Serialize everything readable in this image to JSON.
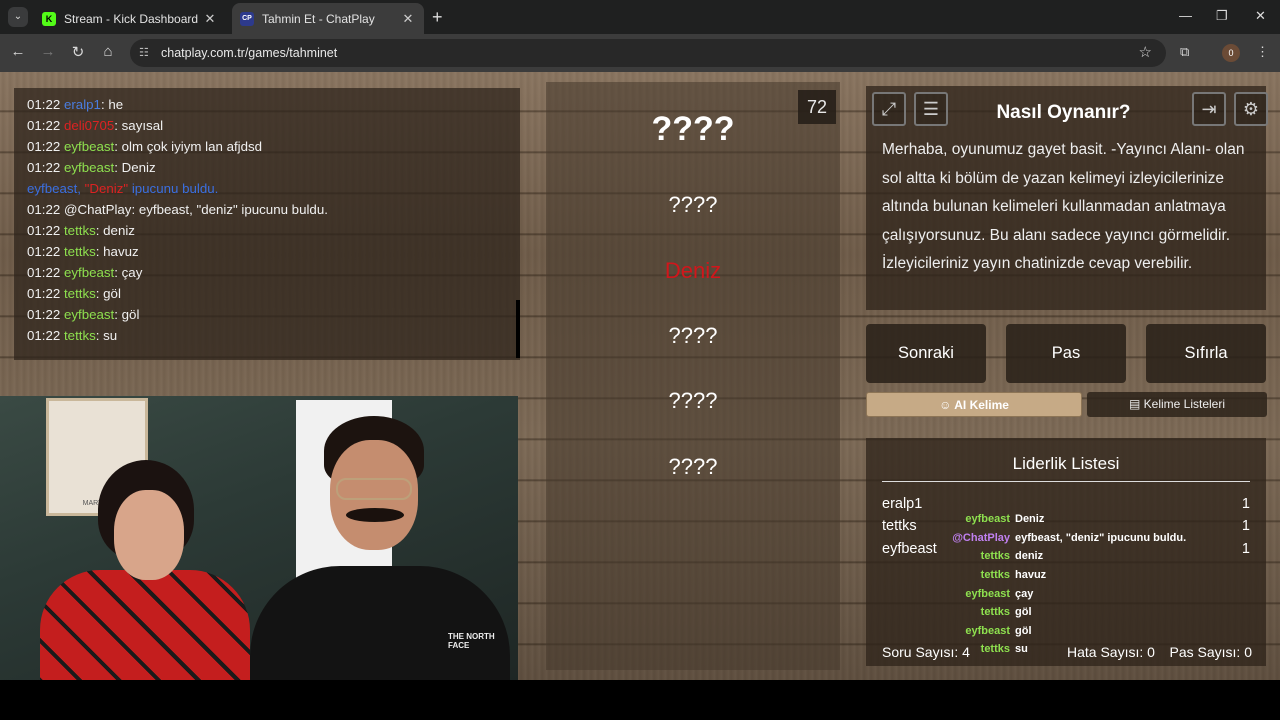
{
  "browser": {
    "tabs": [
      {
        "label": "Stream - Kick Dashboard",
        "favicon": "K",
        "active": false
      },
      {
        "label": "Tahmin Et - ChatPlay",
        "favicon": "CP",
        "active": true
      }
    ],
    "url": "chatplay.com.tr/games/tahminet",
    "profile_initial": "0"
  },
  "chat": [
    {
      "time": "01:22",
      "user": "eralp1",
      "color": "blue",
      "message": "he"
    },
    {
      "time": "01:22",
      "user": "deli0705",
      "color": "red",
      "message": "sayısal"
    },
    {
      "time": "01:22",
      "user": "eyfbeast",
      "color": "green",
      "message": "olm çok iyiym lan afjdsd"
    },
    {
      "time": "01:22",
      "user": "eyfbeast",
      "color": "green",
      "message": "Deniz"
    },
    {
      "notice_user": "eyfbeast,",
      "notice_word": "\"Deniz\"",
      "notice_text": "ipucunu buldu."
    },
    {
      "time": "01:22",
      "user": "@ChatPlay",
      "color": "white",
      "message": "eyfbeast, \"deniz\" ipucunu buldu."
    },
    {
      "time": "01:22",
      "user": "tettks",
      "color": "green",
      "message": "deniz"
    },
    {
      "time": "01:22",
      "user": "tettks",
      "color": "green",
      "message": "havuz"
    },
    {
      "time": "01:22",
      "user": "eyfbeast",
      "color": "green",
      "message": "çay"
    },
    {
      "time": "01:22",
      "user": "tettks",
      "color": "green",
      "message": "göl"
    },
    {
      "time": "01:22",
      "user": "eyfbeast",
      "color": "green",
      "message": "göl"
    },
    {
      "time": "01:22",
      "user": "tettks",
      "color": "green",
      "message": "su"
    }
  ],
  "webcam": {
    "poster_label": "MARTINI",
    "shirt_brand": "THE NORTH FACE"
  },
  "game": {
    "timer": "72",
    "main_word": "????",
    "hints": [
      "????",
      "Deniz",
      "????",
      "????",
      "????"
    ]
  },
  "howto": {
    "title": "Nasıl Oynanır?",
    "text": "Merhaba, oyunumuz gayet basit. -Yayıncı Alanı- olan sol altta ki bölüm de yazan kelimeyi izleyicilerinize altında bulunan kelimeleri kullanmadan anlatmaya çalışıyorsunuz. Bu alanı sadece yayıncı görmelidir. İzleyicileriniz yayın chatinizde cevap verebilir."
  },
  "actions": {
    "next": "Sonraki",
    "pass": "Pas",
    "reset": "Sıfırla"
  },
  "tabs": {
    "ai": "AI Kelime",
    "lists": "Kelime Listeleri"
  },
  "leaderboard": {
    "title": "Liderlik Listesi",
    "rows": [
      {
        "name": "eralp1",
        "score": "1"
      },
      {
        "name": "tettks",
        "score": "1"
      },
      {
        "name": "eyfbeast",
        "score": "1"
      }
    ],
    "stats": {
      "questions": "Soru Sayısı: 4",
      "errors": "Hata Sayısı: 0",
      "passes": "Pas Sayısı: 0"
    }
  },
  "chat_overlay": [
    {
      "user": "eyfbeast",
      "color": "green",
      "message": "Deniz"
    },
    {
      "user": "@ChatPlay",
      "color": "purple",
      "message": "eyfbeast, \"deniz\" ipucunu buldu."
    },
    {
      "user": "tettks",
      "color": "green",
      "message": "deniz"
    },
    {
      "user": "tettks",
      "color": "green",
      "message": "havuz"
    },
    {
      "user": "eyfbeast",
      "color": "green",
      "message": "çay"
    },
    {
      "user": "tettks",
      "color": "green",
      "message": "göl"
    },
    {
      "user": "eyfbeast",
      "color": "green",
      "message": "göl"
    },
    {
      "user": "tettks",
      "color": "green",
      "message": "su"
    }
  ],
  "colors": {
    "accent_red": "#d1161b",
    "chat_green": "#8ee04f",
    "chat_blue": "#4a7de0",
    "tab_active": "#c6aa86"
  }
}
